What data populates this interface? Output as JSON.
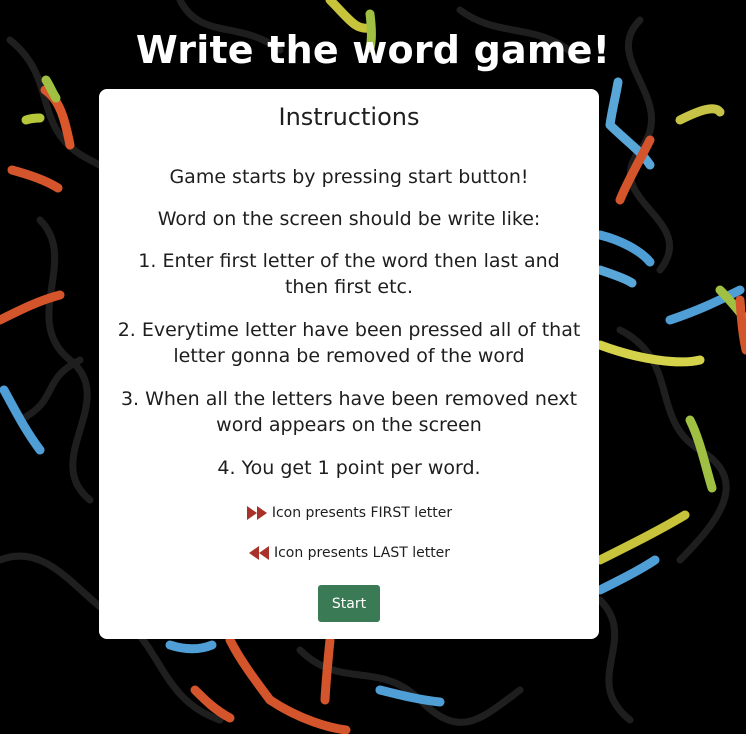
{
  "page": {
    "title": "Write the word game!"
  },
  "instructions": {
    "heading": "Instructions",
    "lines": [
      "Game starts by pressing start button!",
      "Word on the screen should be write like:",
      "1. Enter first letter of the word then last and then first etc.",
      "2. Everytime letter have been pressed all of that letter gonna be removed of the word",
      "3. When all the letters have been removed next word appears on the screen",
      "4. You get 1 point per word."
    ],
    "first_icon_text": "Icon presents FIRST letter",
    "last_icon_text": "Icon presents LAST letter"
  },
  "start_button": {
    "label": "Start"
  },
  "colors": {
    "background": "#000000",
    "card": "#ffffff",
    "button": "#3a7a55",
    "icon": "#a8322a"
  },
  "icons": {
    "first": "fast-forward-icon",
    "last": "rewind-icon"
  }
}
